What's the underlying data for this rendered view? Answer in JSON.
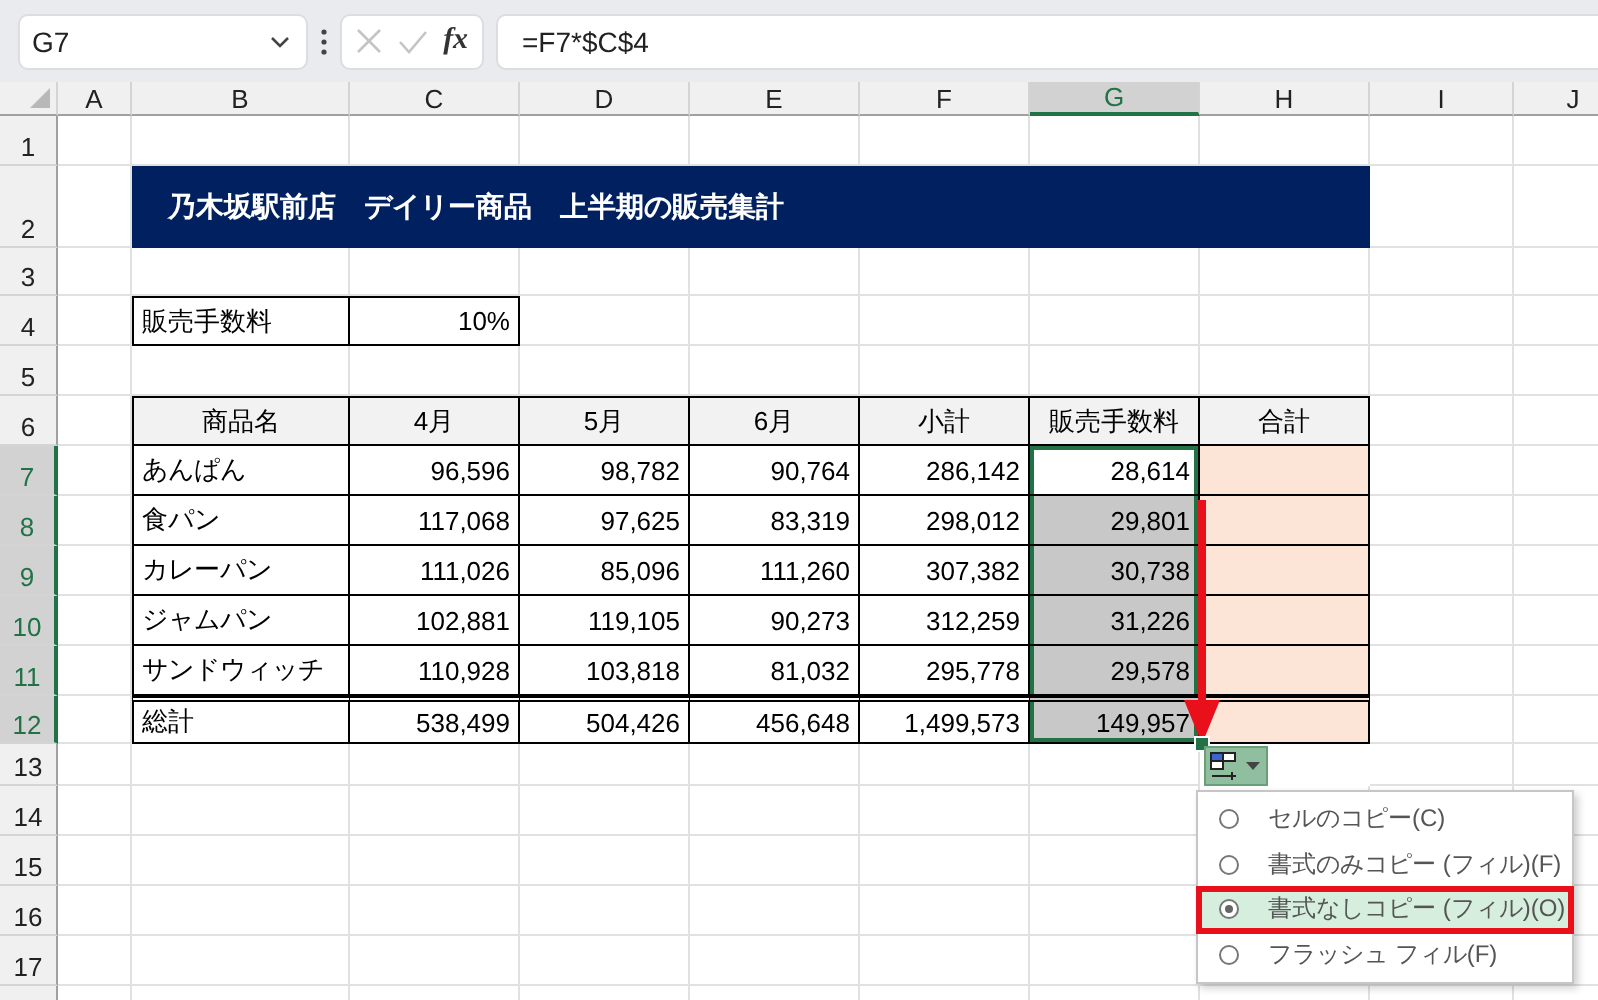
{
  "name_box": {
    "value": "G7"
  },
  "formula_bar": {
    "fx": "fx",
    "formula": "=F7*$C$4"
  },
  "columns": [
    {
      "label": "A",
      "selected": false
    },
    {
      "label": "B",
      "selected": false
    },
    {
      "label": "C",
      "selected": false
    },
    {
      "label": "D",
      "selected": false
    },
    {
      "label": "E",
      "selected": false
    },
    {
      "label": "F",
      "selected": false
    },
    {
      "label": "G",
      "selected": true
    },
    {
      "label": "H",
      "selected": false
    },
    {
      "label": "I",
      "selected": false
    },
    {
      "label": "J",
      "selected": false
    }
  ],
  "rows": [
    {
      "label": "1",
      "selected": false
    },
    {
      "label": "2",
      "selected": false
    },
    {
      "label": "3",
      "selected": false
    },
    {
      "label": "4",
      "selected": false
    },
    {
      "label": "5",
      "selected": false
    },
    {
      "label": "6",
      "selected": false
    },
    {
      "label": "7",
      "selected": true
    },
    {
      "label": "8",
      "selected": true
    },
    {
      "label": "9",
      "selected": true
    },
    {
      "label": "10",
      "selected": true
    },
    {
      "label": "11",
      "selected": true
    },
    {
      "label": "12",
      "selected": true
    },
    {
      "label": "13",
      "selected": false
    },
    {
      "label": "14",
      "selected": false
    },
    {
      "label": "15",
      "selected": false
    },
    {
      "label": "16",
      "selected": false
    },
    {
      "label": "17",
      "selected": false
    }
  ],
  "sheet": {
    "title": "乃木坂駅前店　デイリー商品　上半期の販売集計",
    "fee": {
      "label": "販売手数料",
      "value": "10%"
    },
    "table": {
      "columns": [
        "商品名",
        "4月",
        "5月",
        "6月",
        "小計",
        "販売手数料",
        "合計"
      ],
      "rows": [
        {
          "kind": "item",
          "filled": false,
          "cells": [
            "あんぱん",
            "96,596",
            "98,782",
            "90,764",
            "286,142",
            "28,614"
          ]
        },
        {
          "kind": "item",
          "filled": true,
          "cells": [
            "食パン",
            "117,068",
            "97,625",
            "83,319",
            "298,012",
            "29,801"
          ]
        },
        {
          "kind": "item",
          "filled": true,
          "cells": [
            "カレーパン",
            "111,026",
            "85,096",
            "111,260",
            "307,382",
            "30,738"
          ]
        },
        {
          "kind": "item",
          "filled": true,
          "cells": [
            "ジャムパン",
            "102,881",
            "119,105",
            "90,273",
            "312,259",
            "31,226"
          ]
        },
        {
          "kind": "item",
          "filled": true,
          "cells": [
            "サンドウィッチ",
            "110,928",
            "103,818",
            "81,032",
            "295,778",
            "29,578"
          ]
        },
        {
          "kind": "total",
          "filled": true,
          "cells": [
            "総計",
            "538,499",
            "504,426",
            "456,648",
            "1,499,573",
            "149,957"
          ]
        }
      ]
    }
  },
  "paste_options": {
    "items": [
      {
        "label": "セルのコピー(C)",
        "selected": false
      },
      {
        "label": "書式のみコピー (フィル)(F)",
        "selected": false
      },
      {
        "label": "書式なしコピー (フィル)(O)",
        "selected": true
      },
      {
        "label": "フラッシュ フィル(F)",
        "selected": false
      }
    ]
  }
}
